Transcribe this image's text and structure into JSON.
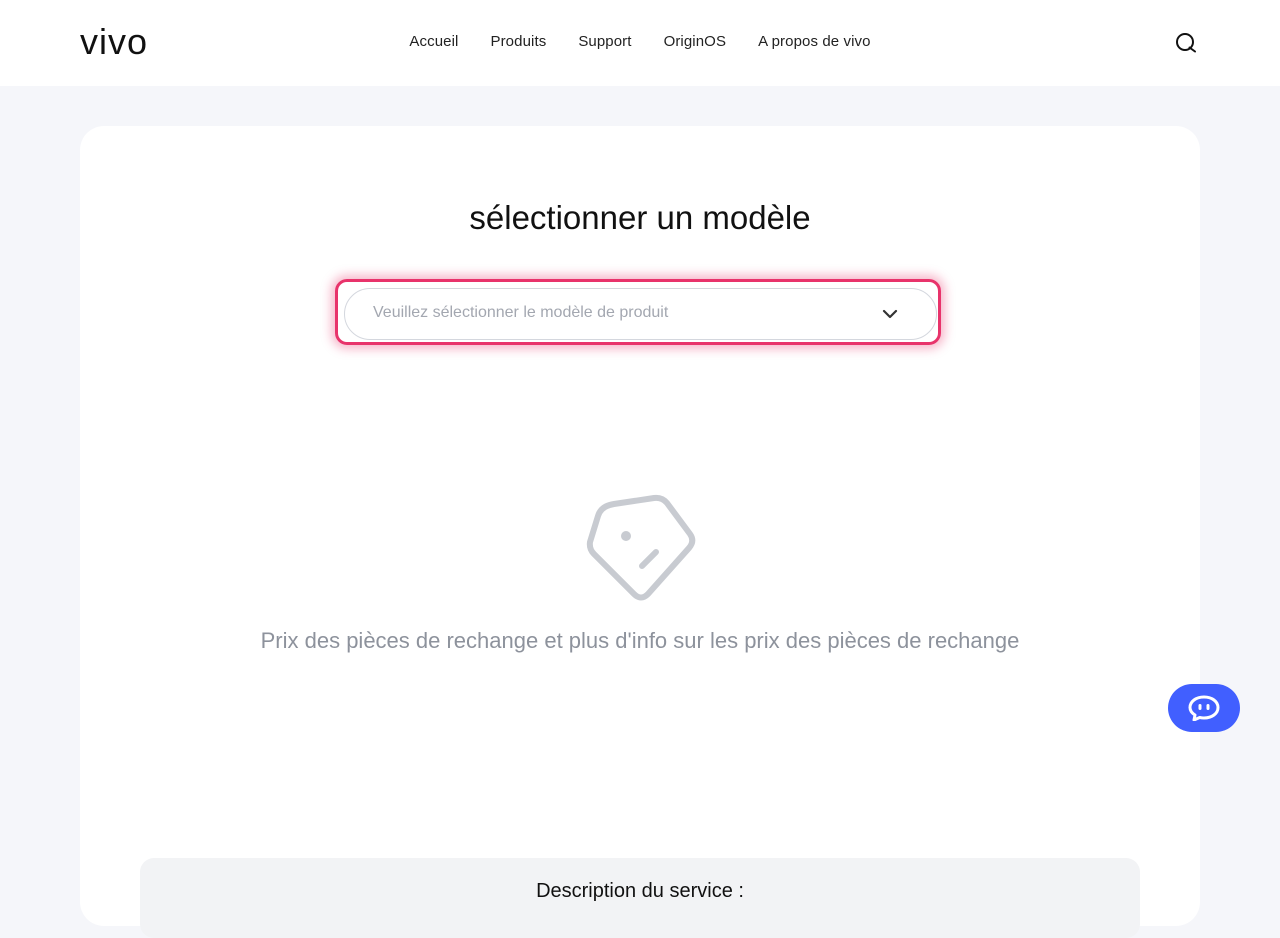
{
  "header": {
    "logo_text": "vivo",
    "nav": [
      {
        "label": "Accueil"
      },
      {
        "label": "Produits"
      },
      {
        "label": "Support"
      },
      {
        "label": "OriginOS"
      },
      {
        "label": "A propos de vivo"
      }
    ],
    "search_icon": "search-icon"
  },
  "main": {
    "title": "sélectionner un modèle",
    "select_placeholder": "Veuillez sélectionner le modèle de produit",
    "empty_icon": "price-tag-icon",
    "empty_text": "Prix des pièces de rechange et plus d'info sur les prix des pièces de rechange",
    "description_title": "Description du service :"
  },
  "chat": {
    "icon": "chatbot-icon"
  },
  "colors": {
    "accent": "#415fff",
    "highlight": "#e8336b",
    "background": "#f5f6fa",
    "muted_text": "#8d929c"
  }
}
